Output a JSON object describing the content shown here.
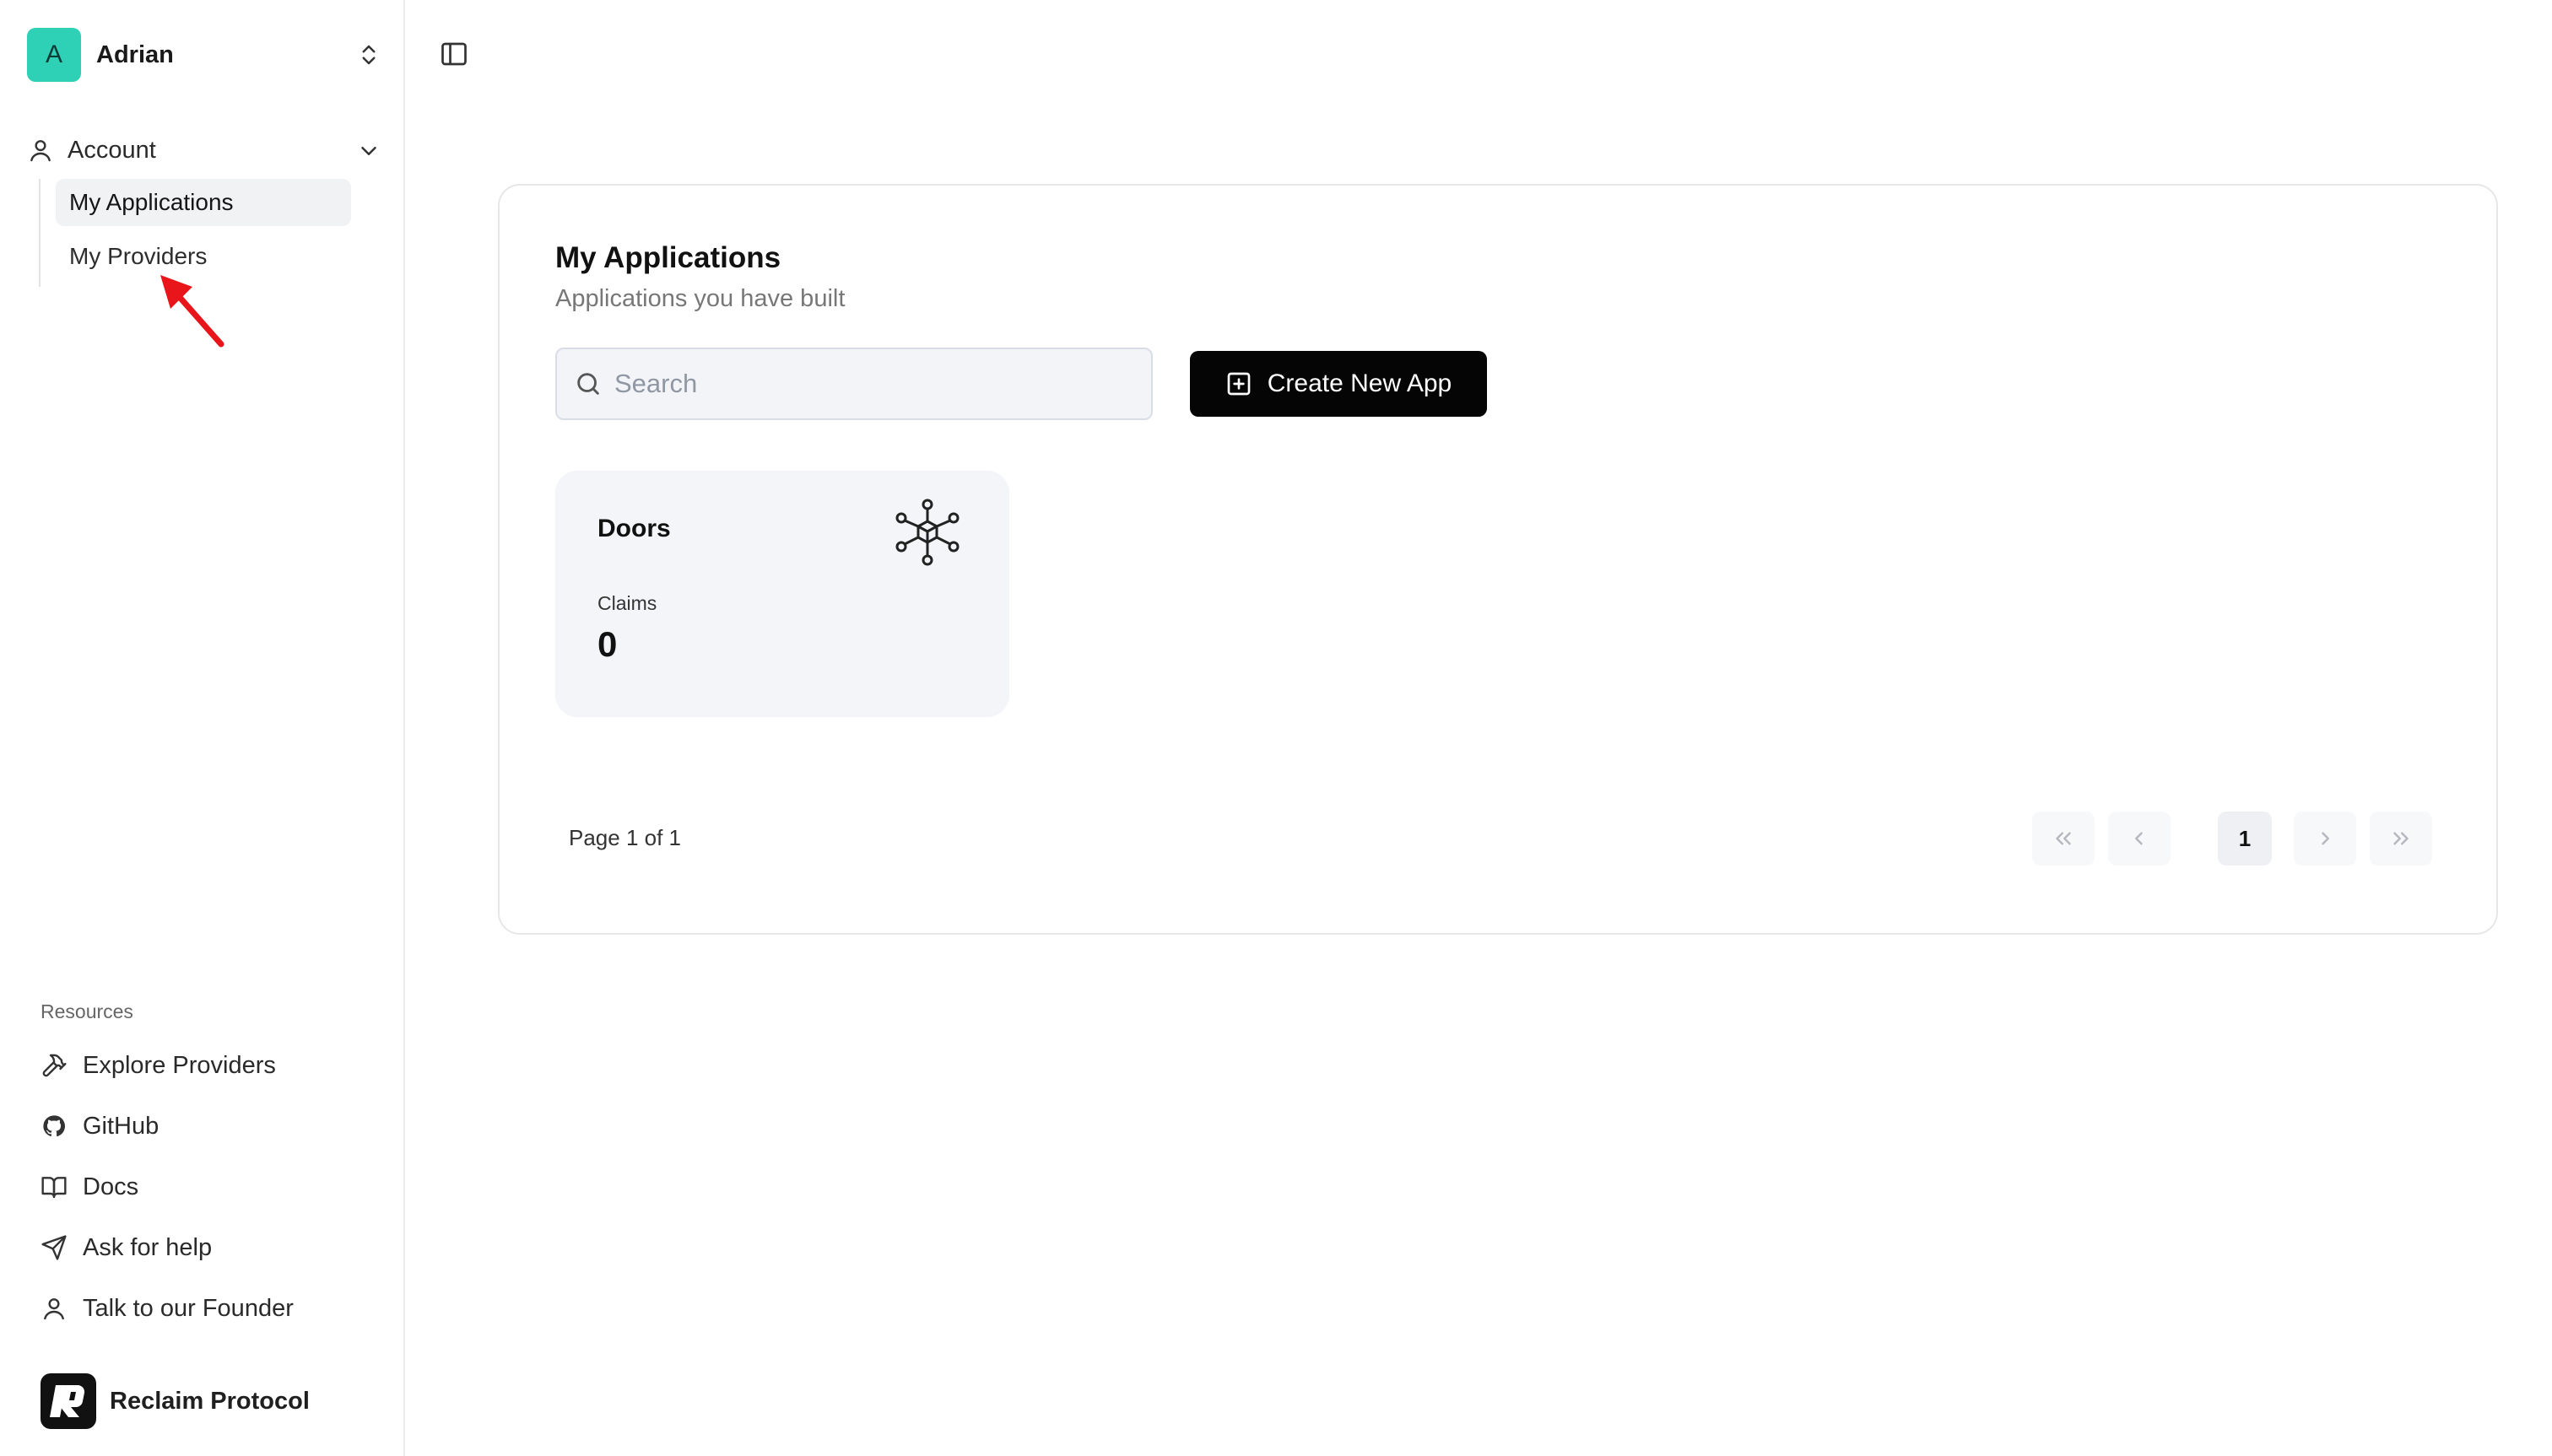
{
  "user": {
    "initial": "A",
    "name": "Adrian"
  },
  "nav": {
    "section_label": "Account",
    "items": [
      {
        "label": "My Applications",
        "active": true
      },
      {
        "label": "My Providers",
        "active": false
      }
    ]
  },
  "resources": {
    "title": "Resources",
    "items": [
      {
        "label": "Explore Providers",
        "icon": "hammer-icon"
      },
      {
        "label": "GitHub",
        "icon": "github-icon"
      },
      {
        "label": "Docs",
        "icon": "book-icon"
      },
      {
        "label": "Ask for help",
        "icon": "send-icon"
      },
      {
        "label": "Talk to our Founder",
        "icon": "user-icon"
      }
    ]
  },
  "brand": {
    "name": "Reclaim Protocol"
  },
  "main": {
    "title": "My Applications",
    "subtitle": "Applications you have built",
    "search_placeholder": "Search",
    "create_label": "Create New App",
    "apps": [
      {
        "name": "Doors",
        "claims_label": "Claims",
        "claims_value": "0"
      }
    ],
    "pagination": {
      "info": "Page 1 of 1",
      "current": "1"
    }
  },
  "colors": {
    "avatar": "#2fd1b6",
    "primary_button": "#050505",
    "card_bg": "#f3f5f9",
    "annotation_arrow": "#e8161b"
  }
}
